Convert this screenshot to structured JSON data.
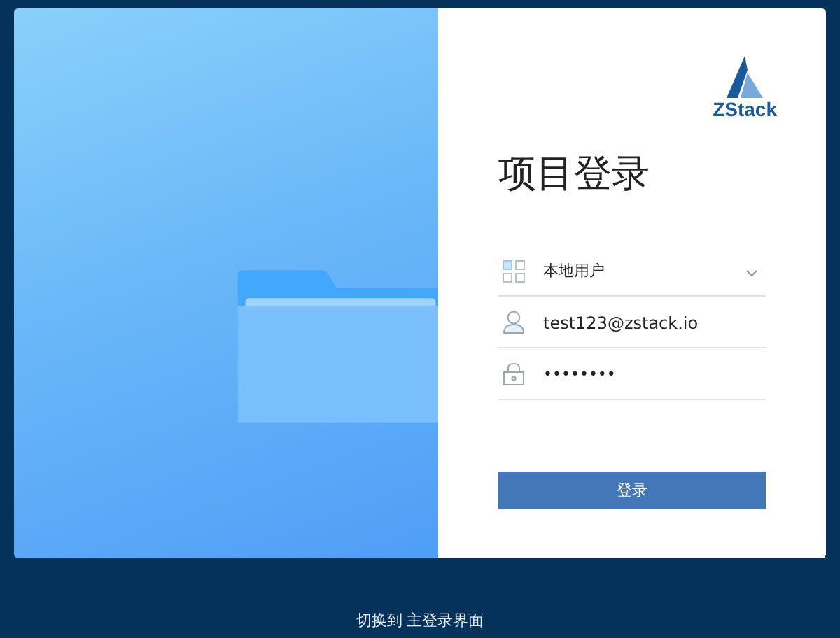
{
  "logo": {
    "text": "ZStack"
  },
  "title": "项目登录",
  "fields": [
    {
      "kind": "select",
      "value": "本地用户"
    },
    {
      "kind": "user",
      "value": "test123@zstack.io"
    },
    {
      "kind": "password",
      "value": "••••••••"
    }
  ],
  "login_button": "登录",
  "footer_link": "切换到 主登录界面"
}
